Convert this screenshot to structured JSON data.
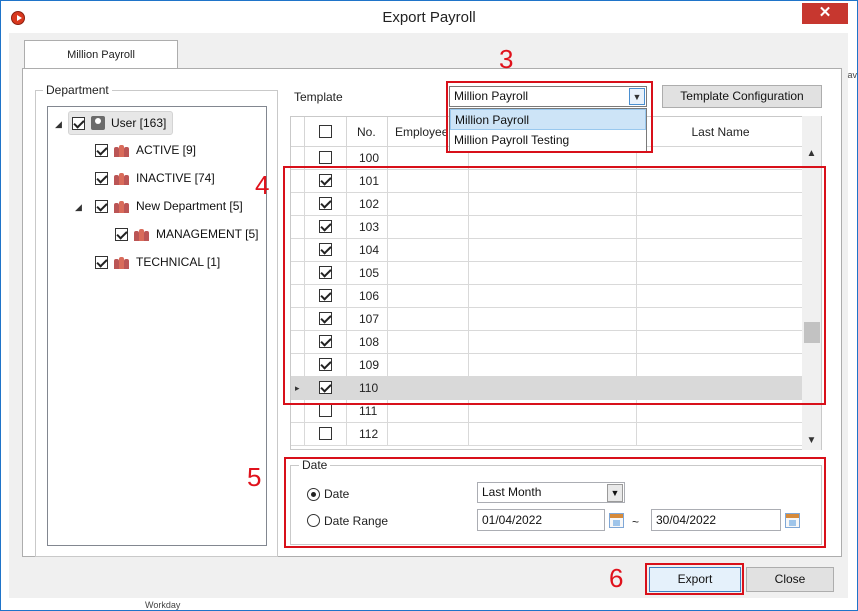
{
  "window": {
    "title": "Export Payroll",
    "close_glyph": "✕"
  },
  "tab": {
    "label": "Million Payroll"
  },
  "department": {
    "legend": "Department",
    "nodes": [
      {
        "label": "User [163]",
        "icon": "user-icon"
      },
      {
        "label": "ACTIVE [9]",
        "icon": "group-icon"
      },
      {
        "label": "INACTIVE [74]",
        "icon": "group-icon"
      },
      {
        "label": "New Department [5]",
        "icon": "group-icon"
      },
      {
        "label": "MANAGEMENT [5]",
        "icon": "group-icon"
      },
      {
        "label": "TECHNICAL [1]",
        "icon": "group-icon"
      }
    ]
  },
  "template": {
    "label": "Template",
    "selected": "Million Payroll",
    "options": [
      "Million Payroll",
      "Million Payroll Testing"
    ],
    "config_button": "Template Configuration"
  },
  "grid": {
    "columns": [
      "No.",
      "Employee",
      "Last Name"
    ],
    "rows": [
      {
        "no": "100",
        "checked": false
      },
      {
        "no": "101",
        "checked": true
      },
      {
        "no": "102",
        "checked": true
      },
      {
        "no": "103",
        "checked": true
      },
      {
        "no": "104",
        "checked": true
      },
      {
        "no": "105",
        "checked": true
      },
      {
        "no": "106",
        "checked": true
      },
      {
        "no": "107",
        "checked": true
      },
      {
        "no": "108",
        "checked": true
      },
      {
        "no": "109",
        "checked": true
      },
      {
        "no": "110",
        "checked": true
      },
      {
        "no": "111",
        "checked": false
      },
      {
        "no": "112",
        "checked": false
      }
    ],
    "current_row_marker": "▸"
  },
  "date": {
    "legend": "Date",
    "option_date": "Date",
    "option_range": "Date Range",
    "period": "Last Month",
    "from": "01/04/2022",
    "tilde": "~",
    "to": "30/04/2022"
  },
  "buttons": {
    "export": "Export",
    "close": "Close"
  },
  "annotations": {
    "step3": "3",
    "step4": "4",
    "step5": "5",
    "step6": "6"
  },
  "background": {
    "edge_text": "Workday",
    "edge_char": "av"
  },
  "colors": {
    "annotation_red": "#d8101a",
    "close_red": "#c7372f",
    "selection_blue": "#cde4f7"
  }
}
